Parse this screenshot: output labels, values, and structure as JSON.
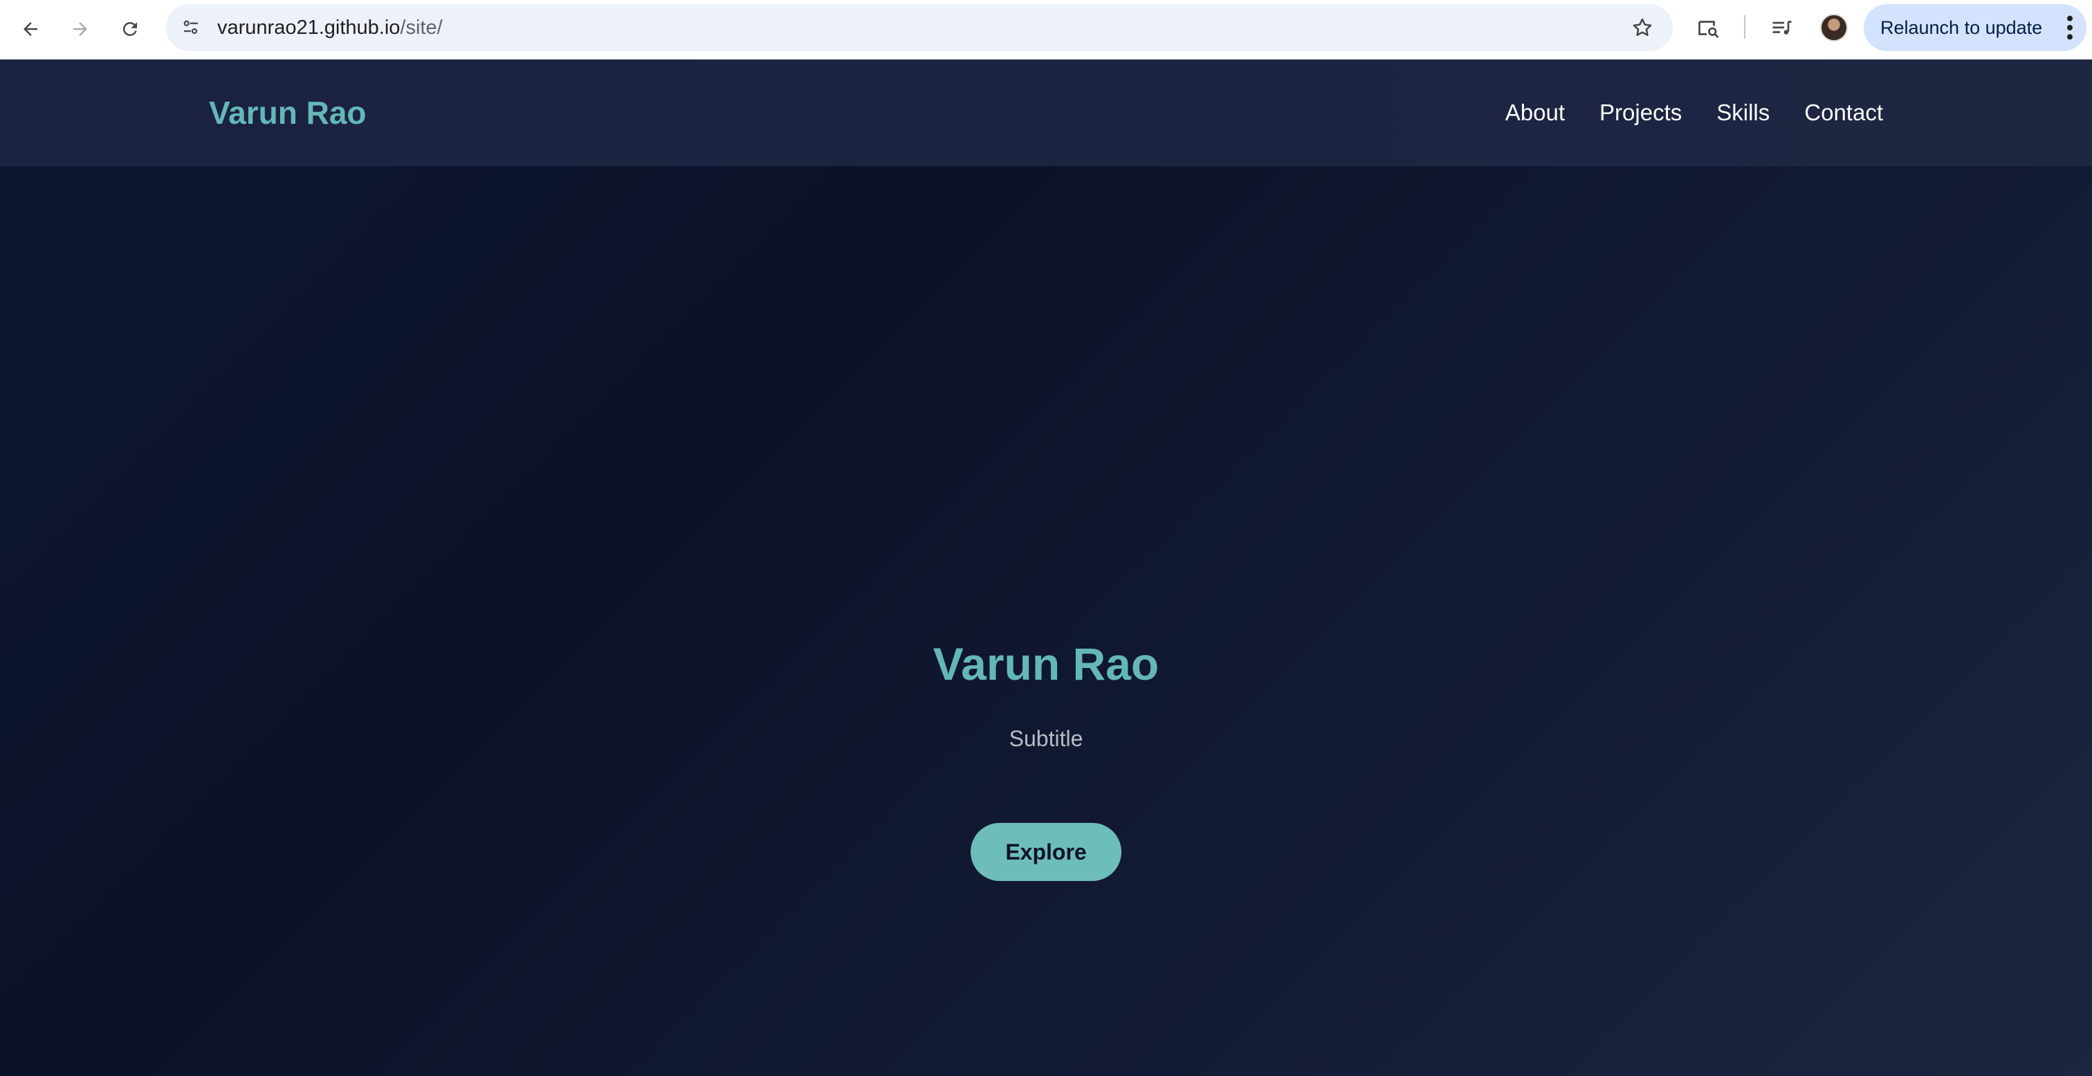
{
  "browser": {
    "url_host": "varunrao21.github.io",
    "url_path": "/site/",
    "relaunch_label": "Relaunch to update",
    "icons": {
      "back": "arrow-left-icon",
      "forward": "arrow-right-icon",
      "reload": "reload-icon",
      "site_info": "tune-icon",
      "bookmark": "star-outline-icon",
      "lens": "lens-search-icon",
      "media": "media-queue-icon",
      "menu": "kebab-menu-icon"
    },
    "colors": {
      "omnibox_bg": "#edf2fa",
      "relaunch_bg": "#d3e3fd"
    }
  },
  "site": {
    "brand": "Varun Rao",
    "nav": [
      {
        "label": "About"
      },
      {
        "label": "Projects"
      },
      {
        "label": "Skills"
      },
      {
        "label": "Contact"
      }
    ],
    "hero": {
      "title": "Varun Rao",
      "subtitle": "Subtitle",
      "cta_label": "Explore"
    },
    "colors": {
      "accent": "#64b7b7",
      "background": "#0d1329",
      "header": "#1e2642"
    }
  }
}
